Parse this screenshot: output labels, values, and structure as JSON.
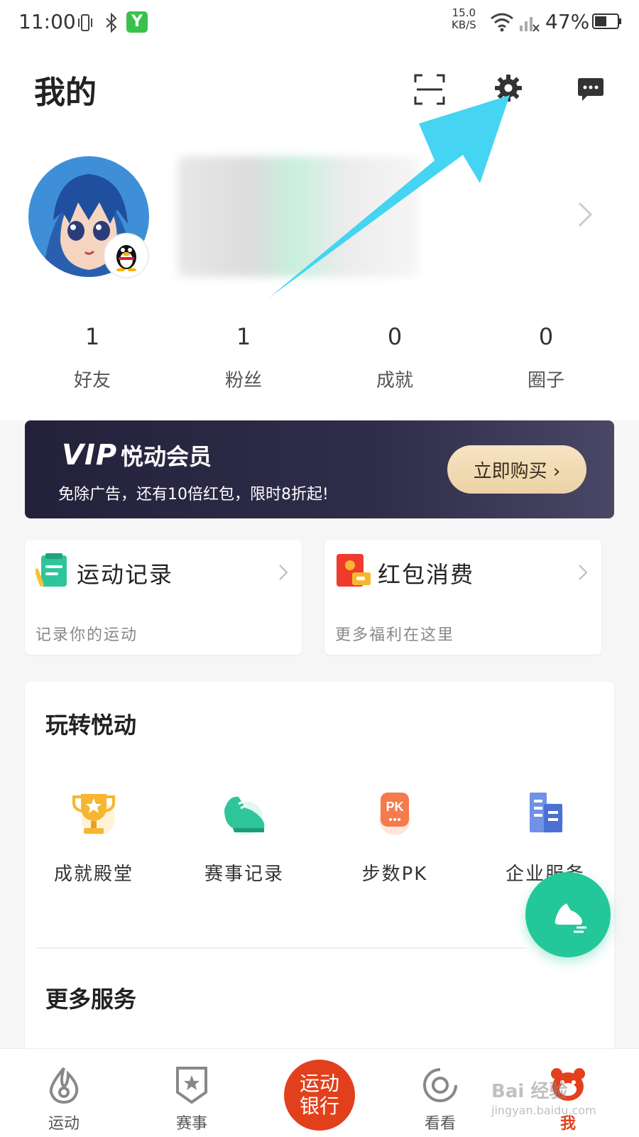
{
  "status_bar": {
    "time": "11:00",
    "speed_value": "15.0",
    "speed_unit": "KB/S",
    "battery": "47%",
    "app_icon": "Y"
  },
  "header": {
    "title": "我的"
  },
  "stats": [
    {
      "value": "1",
      "label": "好友"
    },
    {
      "value": "1",
      "label": "粉丝"
    },
    {
      "value": "0",
      "label": "成就"
    },
    {
      "value": "0",
      "label": "圈子"
    }
  ],
  "vip": {
    "logo": "VIP",
    "title": "悦动会员",
    "subtitle": "免除广告，还有10倍红包，限时8折起!",
    "button": "立即购买 ›"
  },
  "cards": {
    "sport": {
      "title": "运动记录",
      "subtitle": "记录你的运动"
    },
    "red": {
      "title": "红包消费",
      "subtitle": "更多福利在这里"
    }
  },
  "play": {
    "title": "玩转悦动",
    "features": [
      {
        "label": "成就殿堂",
        "icon": "trophy-icon"
      },
      {
        "label": "赛事记录",
        "icon": "shoe-icon"
      },
      {
        "label": "步数PK",
        "icon": "pk-icon"
      },
      {
        "label": "企业服务",
        "icon": "building-icon"
      }
    ]
  },
  "more": {
    "title": "更多服务"
  },
  "bottom_nav": {
    "items": [
      {
        "label": "运动"
      },
      {
        "label": "赛事"
      },
      {
        "label": "运动银行"
      },
      {
        "label": "看看"
      },
      {
        "label": "我"
      }
    ]
  },
  "watermark": {
    "main": "Bai 经验",
    "sub": "jingyan.baidu.com"
  },
  "colors": {
    "accent_green": "#24c79a",
    "bank_red": "#e2401c",
    "arrow_cyan": "#45d4f2",
    "vip_dark": "#23213a",
    "active_nav": "#e2401c"
  }
}
